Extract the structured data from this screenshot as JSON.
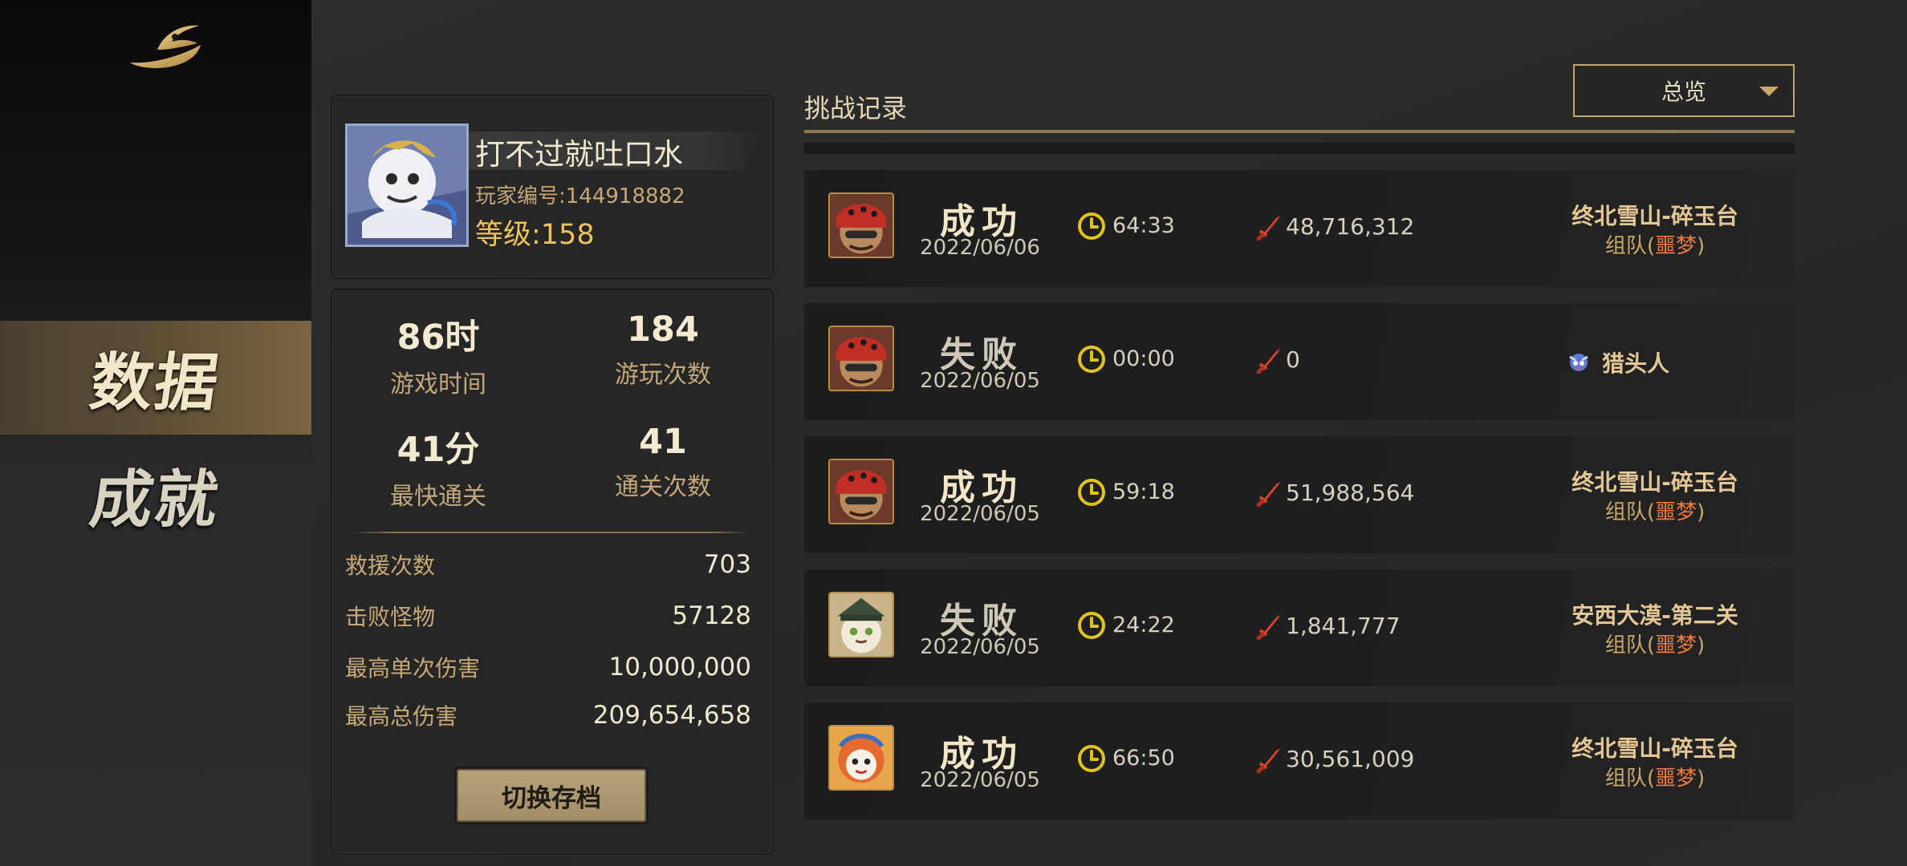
{
  "sidebar": {
    "logo": "game-logo",
    "items": [
      {
        "label": "数据",
        "active": true
      },
      {
        "label": "成就",
        "active": false
      }
    ]
  },
  "profile": {
    "name": "打不过就吐口水",
    "player_id": "玩家编号:144918882",
    "level": "等级:158"
  },
  "stats": {
    "play_time": {
      "value": "86时",
      "label": "游戏时间"
    },
    "play_count": {
      "value": "184",
      "label": "游玩次数"
    },
    "fastest_clear": {
      "value": "41分",
      "label": "最快通关"
    },
    "clear_count": {
      "value": "41",
      "label": "通关次数"
    },
    "rows": [
      {
        "label": "救援次数",
        "value": "703"
      },
      {
        "label": "击败怪物",
        "value": "57128"
      },
      {
        "label": "最高单次伤害",
        "value": "10,000,000"
      },
      {
        "label": "最高总伤害",
        "value": "209,654,658"
      }
    ],
    "switch_button": "切换存档"
  },
  "records": {
    "title": "挑战记录",
    "filter": "总览",
    "items": [
      {
        "result": "成功",
        "win": true,
        "date": "2022/06/06",
        "time": "64:33",
        "damage": "48,716,312",
        "stage": "终北雪山-碎玉台",
        "mode_prefix": "组队(",
        "mode_hl": "噩梦",
        "mode_suffix": ")",
        "solo": "",
        "avatar": "red-hood"
      },
      {
        "result": "失败",
        "win": false,
        "date": "2022/06/05",
        "time": "00:00",
        "damage": "0",
        "stage": "",
        "mode_prefix": "",
        "mode_hl": "",
        "mode_suffix": "",
        "solo": "猎头人",
        "avatar": "red-hood"
      },
      {
        "result": "成功",
        "win": true,
        "date": "2022/06/05",
        "time": "59:18",
        "damage": "51,988,564",
        "stage": "终北雪山-碎玉台",
        "mode_prefix": "组队(",
        "mode_hl": "噩梦",
        "mode_suffix": ")",
        "solo": "",
        "avatar": "red-hood"
      },
      {
        "result": "失败",
        "win": false,
        "date": "2022/06/05",
        "time": "24:22",
        "damage": "1,841,777",
        "stage": "安西大漠-第二关",
        "mode_prefix": "组队(",
        "mode_hl": "噩梦",
        "mode_suffix": ")",
        "solo": "",
        "avatar": "cat-hat"
      },
      {
        "result": "成功",
        "win": true,
        "date": "2022/06/05",
        "time": "66:50",
        "damage": "30,561,009",
        "stage": "终北雪山-碎玉台",
        "mode_prefix": "组队(",
        "mode_hl": "噩梦",
        "mode_suffix": ")",
        "solo": "",
        "avatar": "lion-dance"
      }
    ]
  },
  "colors": {
    "accent_gold": "#c9a86a",
    "nightmare": "#f07a3c",
    "level": "#f0c35a"
  }
}
